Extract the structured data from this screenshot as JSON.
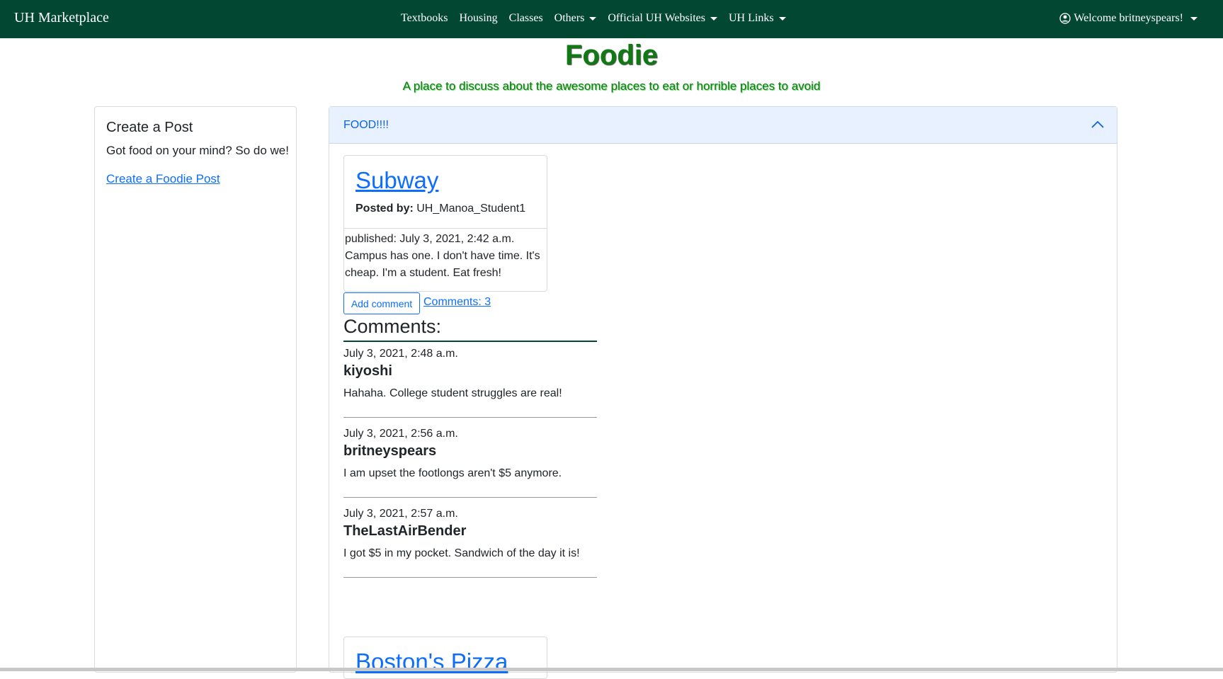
{
  "nav": {
    "brand": "UH Marketplace",
    "links": [
      {
        "label": "Textbooks"
      },
      {
        "label": "Housing"
      },
      {
        "label": "Classes"
      },
      {
        "label": "Others"
      },
      {
        "label": "Official UH Websites"
      },
      {
        "label": "UH Links"
      }
    ],
    "user": "Welcome britneyspears!"
  },
  "header": {
    "title": "Foodie",
    "subtitle": "A place to discuss about the awesome places to eat or horrible places to avoid"
  },
  "sidebar": {
    "title": "Create a Post",
    "tagline": "Got food on your mind? So do we!",
    "link": "Create a Foodie Post"
  },
  "accordion": {
    "title": "FOOD!!!!",
    "posts": [
      {
        "title": "Subway",
        "posted_by_label": "Posted by:",
        "author": "UH_Manoa_Student1",
        "published": "published: July 3, 2021, 2:42 a.m.",
        "body": "Campus has one. I don't have time. It's cheap. I'm a student. Eat fresh!",
        "add_comment": "Add comment",
        "comments_link": "Comments: 3",
        "comments_heading": "Comments:",
        "comments": [
          {
            "date": "July 3, 2021, 2:48 a.m.",
            "user": "kiyoshi",
            "text": "Hahaha. College student struggles are real!"
          },
          {
            "date": "July 3, 2021, 2:56 a.m.",
            "user": "britneyspears",
            "text": "I am upset the footlongs aren't $5 anymore."
          },
          {
            "date": "July 3, 2021, 2:57 a.m.",
            "user": "TheLastAirBender",
            "text": "I got $5 in my pocket. Sandwich of the day it is!"
          }
        ]
      },
      {
        "title": "Boston's Pizza"
      }
    ]
  }
}
